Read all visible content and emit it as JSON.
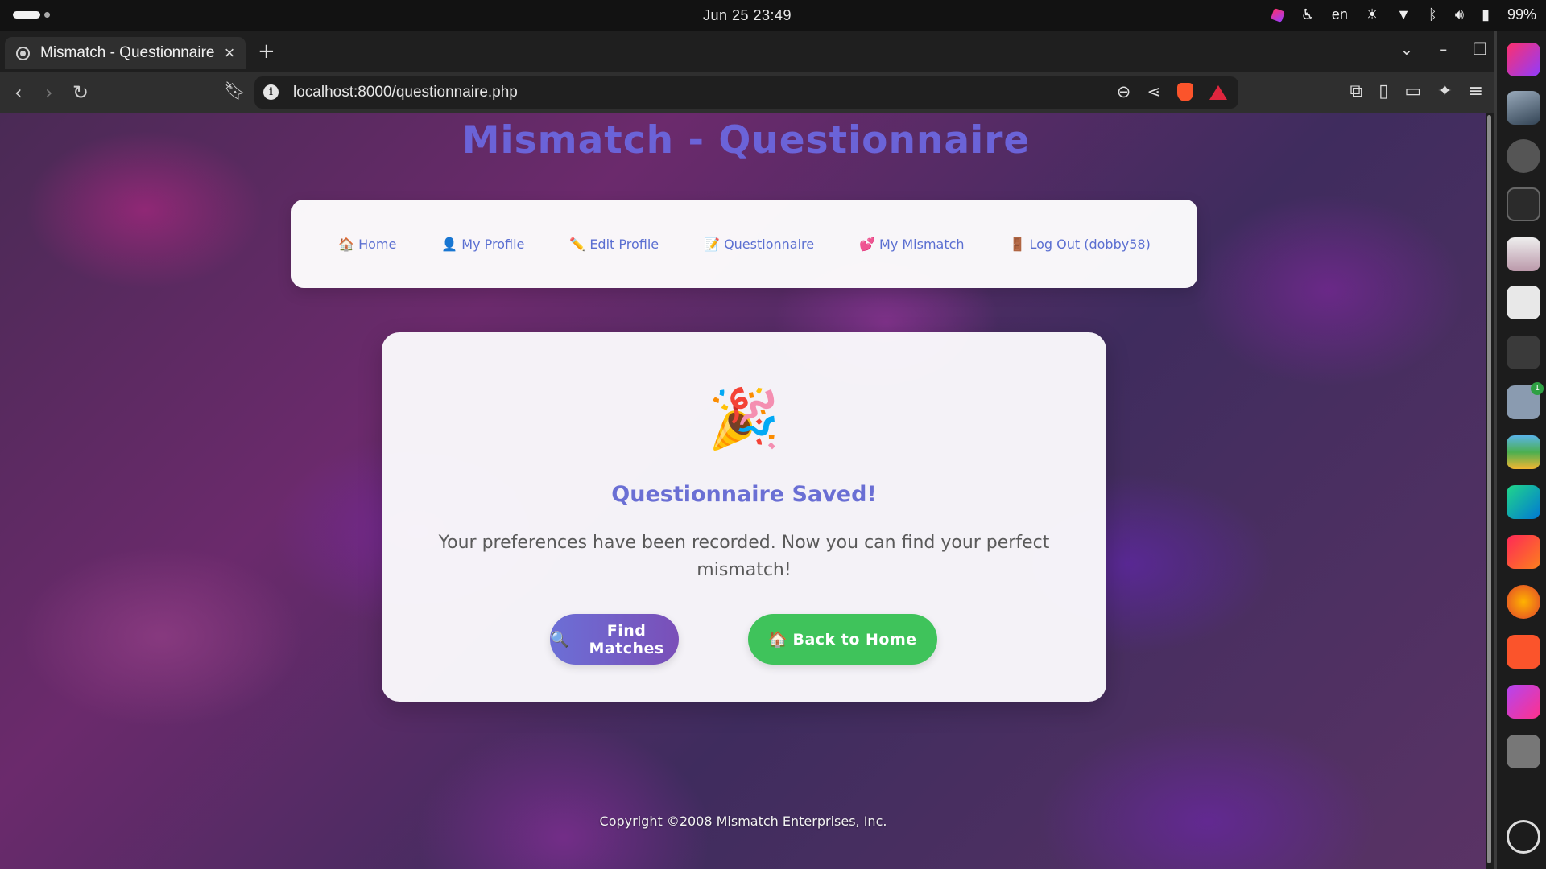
{
  "system": {
    "clock": "Jun 25  23:49",
    "language": "en",
    "battery": "99%"
  },
  "browser": {
    "tab_title": "Mismatch - Questionnaire",
    "url": "localhost:8000/questionnaire.php"
  },
  "page": {
    "site_title": "Mismatch - Questionnaire",
    "nav": [
      {
        "emoji": "🏠",
        "label": "Home"
      },
      {
        "emoji": "👤",
        "label": "My Profile"
      },
      {
        "emoji": "✏️",
        "label": "Edit Profile"
      },
      {
        "emoji": "📝",
        "label": "Questionnaire"
      },
      {
        "emoji": "💕",
        "label": "My Mismatch"
      },
      {
        "emoji": "🚪",
        "label": "Log Out (dobby58)"
      }
    ],
    "card": {
      "emoji": "🎉",
      "heading": "Questionnaire Saved!",
      "message": "Your preferences have been recorded. Now you can find your perfect mismatch!",
      "find_button": {
        "emoji": "🔍",
        "label": "Find Matches"
      },
      "home_button": {
        "emoji": "🏠",
        "label": "Back to Home"
      }
    },
    "footer": "Copyright ©2008 Mismatch Enterprises, Inc."
  },
  "dock": {
    "files_badge": "1"
  },
  "colors": {
    "title": "#6b63d8",
    "nav_link": "#5b6fd1",
    "heading": "#6a6fd4",
    "find_button": "#6c6fd6",
    "home_button": "#3fc35b"
  }
}
